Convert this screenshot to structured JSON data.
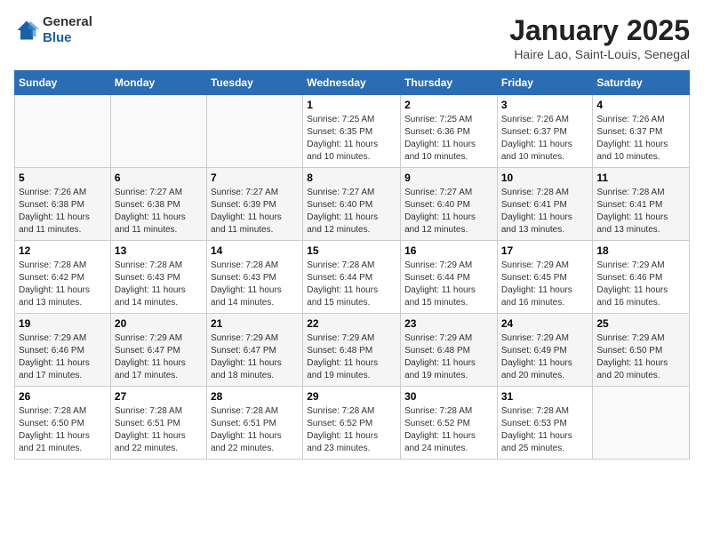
{
  "header": {
    "logo": {
      "general": "General",
      "blue": "Blue"
    },
    "title": "January 2025",
    "subtitle": "Haire Lao, Saint-Louis, Senegal"
  },
  "weekdays": [
    "Sunday",
    "Monday",
    "Tuesday",
    "Wednesday",
    "Thursday",
    "Friday",
    "Saturday"
  ],
  "weeks": [
    [
      {
        "day": "",
        "info": ""
      },
      {
        "day": "",
        "info": ""
      },
      {
        "day": "",
        "info": ""
      },
      {
        "day": "1",
        "info": "Sunrise: 7:25 AM\nSunset: 6:35 PM\nDaylight: 11 hours\nand 10 minutes."
      },
      {
        "day": "2",
        "info": "Sunrise: 7:25 AM\nSunset: 6:36 PM\nDaylight: 11 hours\nand 10 minutes."
      },
      {
        "day": "3",
        "info": "Sunrise: 7:26 AM\nSunset: 6:37 PM\nDaylight: 11 hours\nand 10 minutes."
      },
      {
        "day": "4",
        "info": "Sunrise: 7:26 AM\nSunset: 6:37 PM\nDaylight: 11 hours\nand 10 minutes."
      }
    ],
    [
      {
        "day": "5",
        "info": "Sunrise: 7:26 AM\nSunset: 6:38 PM\nDaylight: 11 hours\nand 11 minutes."
      },
      {
        "day": "6",
        "info": "Sunrise: 7:27 AM\nSunset: 6:38 PM\nDaylight: 11 hours\nand 11 minutes."
      },
      {
        "day": "7",
        "info": "Sunrise: 7:27 AM\nSunset: 6:39 PM\nDaylight: 11 hours\nand 11 minutes."
      },
      {
        "day": "8",
        "info": "Sunrise: 7:27 AM\nSunset: 6:40 PM\nDaylight: 11 hours\nand 12 minutes."
      },
      {
        "day": "9",
        "info": "Sunrise: 7:27 AM\nSunset: 6:40 PM\nDaylight: 11 hours\nand 12 minutes."
      },
      {
        "day": "10",
        "info": "Sunrise: 7:28 AM\nSunset: 6:41 PM\nDaylight: 11 hours\nand 13 minutes."
      },
      {
        "day": "11",
        "info": "Sunrise: 7:28 AM\nSunset: 6:41 PM\nDaylight: 11 hours\nand 13 minutes."
      }
    ],
    [
      {
        "day": "12",
        "info": "Sunrise: 7:28 AM\nSunset: 6:42 PM\nDaylight: 11 hours\nand 13 minutes."
      },
      {
        "day": "13",
        "info": "Sunrise: 7:28 AM\nSunset: 6:43 PM\nDaylight: 11 hours\nand 14 minutes."
      },
      {
        "day": "14",
        "info": "Sunrise: 7:28 AM\nSunset: 6:43 PM\nDaylight: 11 hours\nand 14 minutes."
      },
      {
        "day": "15",
        "info": "Sunrise: 7:28 AM\nSunset: 6:44 PM\nDaylight: 11 hours\nand 15 minutes."
      },
      {
        "day": "16",
        "info": "Sunrise: 7:29 AM\nSunset: 6:44 PM\nDaylight: 11 hours\nand 15 minutes."
      },
      {
        "day": "17",
        "info": "Sunrise: 7:29 AM\nSunset: 6:45 PM\nDaylight: 11 hours\nand 16 minutes."
      },
      {
        "day": "18",
        "info": "Sunrise: 7:29 AM\nSunset: 6:46 PM\nDaylight: 11 hours\nand 16 minutes."
      }
    ],
    [
      {
        "day": "19",
        "info": "Sunrise: 7:29 AM\nSunset: 6:46 PM\nDaylight: 11 hours\nand 17 minutes."
      },
      {
        "day": "20",
        "info": "Sunrise: 7:29 AM\nSunset: 6:47 PM\nDaylight: 11 hours\nand 17 minutes."
      },
      {
        "day": "21",
        "info": "Sunrise: 7:29 AM\nSunset: 6:47 PM\nDaylight: 11 hours\nand 18 minutes."
      },
      {
        "day": "22",
        "info": "Sunrise: 7:29 AM\nSunset: 6:48 PM\nDaylight: 11 hours\nand 19 minutes."
      },
      {
        "day": "23",
        "info": "Sunrise: 7:29 AM\nSunset: 6:48 PM\nDaylight: 11 hours\nand 19 minutes."
      },
      {
        "day": "24",
        "info": "Sunrise: 7:29 AM\nSunset: 6:49 PM\nDaylight: 11 hours\nand 20 minutes."
      },
      {
        "day": "25",
        "info": "Sunrise: 7:29 AM\nSunset: 6:50 PM\nDaylight: 11 hours\nand 20 minutes."
      }
    ],
    [
      {
        "day": "26",
        "info": "Sunrise: 7:28 AM\nSunset: 6:50 PM\nDaylight: 11 hours\nand 21 minutes."
      },
      {
        "day": "27",
        "info": "Sunrise: 7:28 AM\nSunset: 6:51 PM\nDaylight: 11 hours\nand 22 minutes."
      },
      {
        "day": "28",
        "info": "Sunrise: 7:28 AM\nSunset: 6:51 PM\nDaylight: 11 hours\nand 22 minutes."
      },
      {
        "day": "29",
        "info": "Sunrise: 7:28 AM\nSunset: 6:52 PM\nDaylight: 11 hours\nand 23 minutes."
      },
      {
        "day": "30",
        "info": "Sunrise: 7:28 AM\nSunset: 6:52 PM\nDaylight: 11 hours\nand 24 minutes."
      },
      {
        "day": "31",
        "info": "Sunrise: 7:28 AM\nSunset: 6:53 PM\nDaylight: 11 hours\nand 25 minutes."
      },
      {
        "day": "",
        "info": ""
      }
    ]
  ]
}
